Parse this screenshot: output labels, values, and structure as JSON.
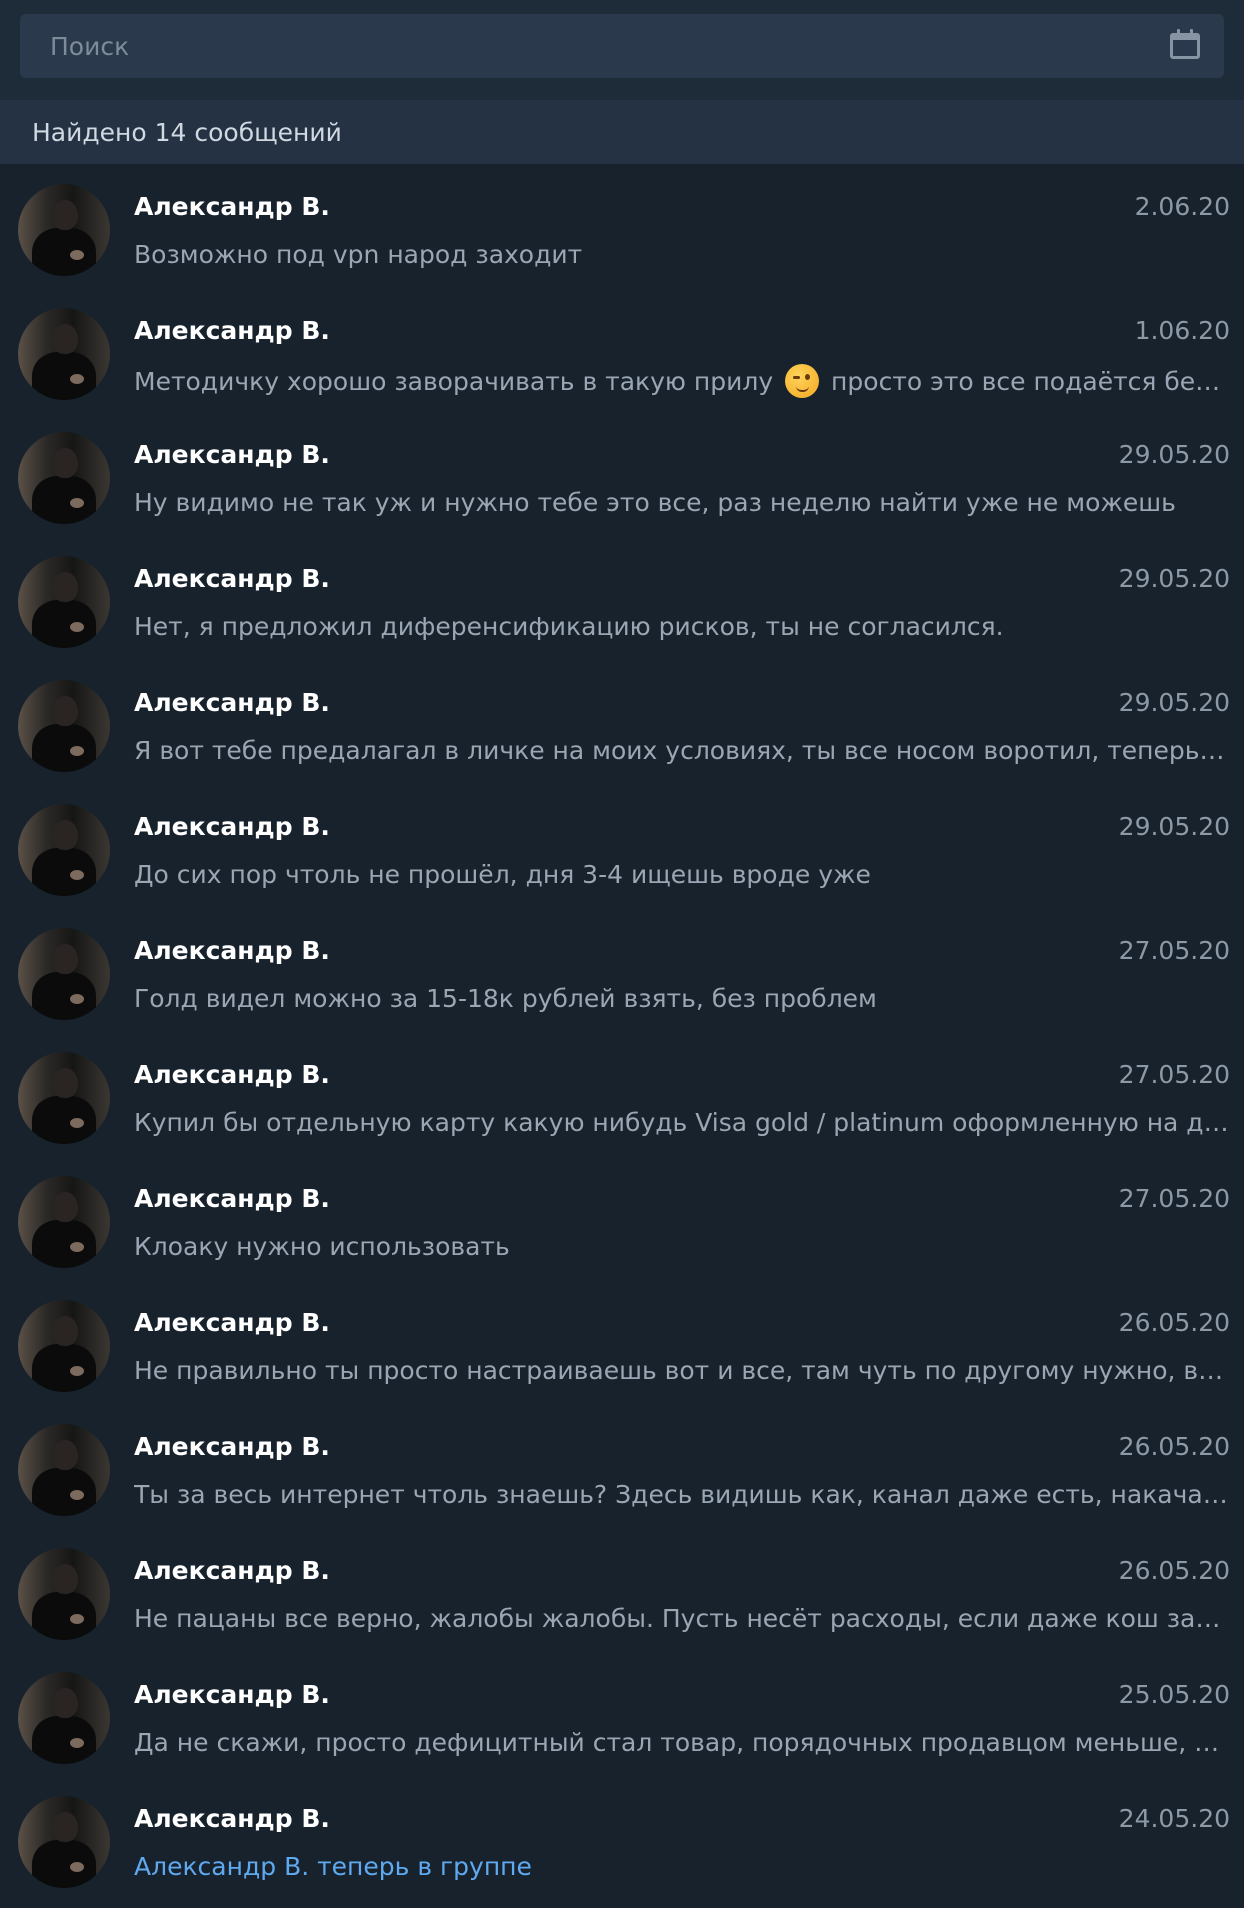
{
  "search": {
    "placeholder": "Поиск",
    "calendar_icon": "calendar-icon"
  },
  "results_header": "Найдено 14 сообщений",
  "messages": [
    {
      "name": "Александр В.",
      "date": "2.06.20",
      "text": "Возможно под vpn народ заходит"
    },
    {
      "name": "Александр В.",
      "date": "1.06.20",
      "text_before": "Методичку хорошо заворачивать в такую прилу ",
      "emoji": "😉",
      "text_after": " просто это все подаётся без на..."
    },
    {
      "name": "Александр В.",
      "date": "29.05.20",
      "text": "Ну видимо не так уж и нужно тебе это все, раз неделю найти уже не можешь"
    },
    {
      "name": "Александр В.",
      "date": "29.05.20",
      "text": "Нет, я предложил диференсификацию рисков, ты не согласился."
    },
    {
      "name": "Александр В.",
      "date": "29.05.20",
      "text": "Я вот тебе предалагал в личке на моих условиях, ты все носом воротил, теперь стра..."
    },
    {
      "name": "Александр В.",
      "date": "29.05.20",
      "text": "До сих пор чтоль не прошёл, дня 3-4 ищешь вроде уже"
    },
    {
      "name": "Александр В.",
      "date": "27.05.20",
      "text": "Голд видел можно за 15-18к рублей взять, без проблем"
    },
    {
      "name": "Александр В.",
      "date": "27.05.20",
      "text": "Купил бы отдельную карту какую нибудь Visa gold / platinum оформленную на друго..."
    },
    {
      "name": "Александр В.",
      "date": "27.05.20",
      "text": "Клоаку нужно использовать"
    },
    {
      "name": "Александр В.",
      "date": "26.05.20",
      "text": "Не правильно ты просто настраиваешь вот и все, там чуть по другому нужно, в хол..."
    },
    {
      "name": "Александр В.",
      "date": "26.05.20",
      "text": "Ты за весь интернет чтоль знаешь? Здесь видишь как, канал даже есть, накачал под..."
    },
    {
      "name": "Александр В.",
      "date": "26.05.20",
      "text": "Не пацаны все верно, жалобы жалобы. Пусть несёт расходы, если даже кош заблоча..."
    },
    {
      "name": "Александр В.",
      "date": "25.05.20",
      "text": "Да не скажи, просто дефицитный стал товар, порядочных продавцом меньше, но о..."
    },
    {
      "name": "Александр В.",
      "date": "24.05.20",
      "text": "Александр В. теперь в группе"
    }
  ]
}
